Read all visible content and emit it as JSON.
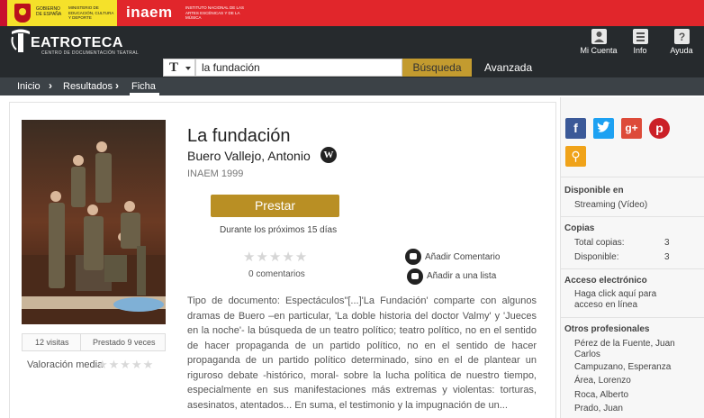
{
  "gov": {
    "gobierno": "Gobierno de España",
    "ministerio": "Ministerio de Educación, Cultura y Deporte",
    "inaem": "inaem",
    "instituto": "Instituto Nacional de las Artes Escénicas y de la Música"
  },
  "header": {
    "logo_text": "EATROTECA",
    "logo_sub": "Centro de documentación teatral",
    "account": "Mi Cuenta",
    "info": "Info",
    "help": "Ayuda"
  },
  "search": {
    "type_glyph": "T",
    "value": "la fundación",
    "button": "Búsqueda",
    "advanced": "Avanzada"
  },
  "breadcrumb": [
    "Inicio",
    "Resultados",
    "Ficha"
  ],
  "record": {
    "title": "La fundación",
    "author": "Buero Vallejo, Antonio",
    "wiki_glyph": "W",
    "edition": "INAEM 1999",
    "borrow": "Prestar",
    "borrow_note": "Durante los próximos 15 días",
    "rating": 0,
    "rating_max": 5,
    "comments": "0 comentarios",
    "add_comment": "Añadir Comentario",
    "add_list": "Añadir a una lista",
    "synopsis": "Tipo de documento: Espectáculos\"[...]'La Fundación' comparte con algunos dramas de Buero –en particular, 'La doble historia del doctor Valmy' y 'Jueces en la noche'- la búsqueda de un teatro político; teatro político, no en el sentido de hacer propaganda de un partido político, no en el sentido de hacer propaganda de un partido político determinado, sino en el de plantear un riguroso debate -histórico, moral- sobre la lucha política de nuestro tiempo, especialmente en sus manifestaciones más extremas y violentas: torturas, asesinatos, atentados... En suma, el testimonio y la impugnación de un...",
    "visits": "12 visitas",
    "loaned": "Prestado 9 veces",
    "valuation_label": "Valoración media",
    "valuation": 0
  },
  "sidebar": {
    "available_head": "Disponible en",
    "available_value": "Streaming (Vídeo)",
    "copies_head": "Copias",
    "total_label": "Total copias:",
    "total_value": "3",
    "avail_label": "Disponible:",
    "avail_value": "3",
    "access_head": "Acceso electrónico",
    "access_text": "Haga click aquí para acceso en línea",
    "others_head": "Otros profesionales",
    "others": [
      "Pérez de la Fuente, Juan Carlos",
      "Campuzano, Esperanza",
      "Área, Lorenzo",
      "Roca, Alberto",
      "Prado, Juan"
    ]
  },
  "colors": {
    "accent": "#c39b2f",
    "borrow": "#b98f24",
    "header_bg": "#262a2d",
    "gov_red": "#e1262b",
    "facebook": "#3b5998",
    "twitter": "#1da1f2",
    "googleplus": "#dd4b39",
    "pinterest": "#cb2027",
    "link": "#f0a31a"
  },
  "icons": {
    "account": "account-icon",
    "info": "info-icon",
    "help": "help-icon",
    "facebook": "facebook-icon",
    "twitter": "twitter-icon",
    "googleplus": "googleplus-icon",
    "pinterest": "pinterest-icon",
    "link": "link-icon"
  }
}
